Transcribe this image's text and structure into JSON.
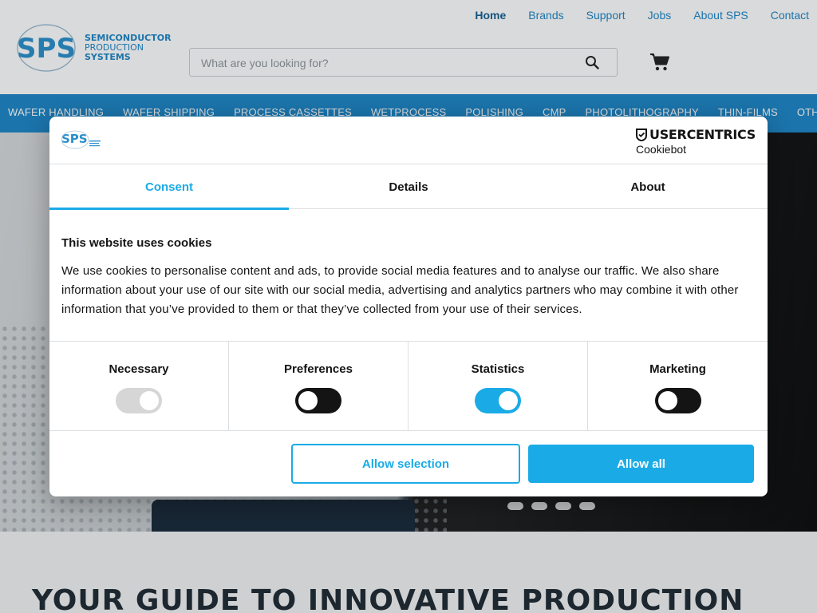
{
  "site": {
    "logo": {
      "mark": "SPS",
      "line1": "SEMICONDUCTOR",
      "line2": "PRODUCTION",
      "line3": "SYSTEMS"
    },
    "top_nav": [
      "Home",
      "Brands",
      "Support",
      "Jobs",
      "About SPS",
      "Contact"
    ],
    "search": {
      "placeholder": "What are you looking for?",
      "value": ""
    },
    "categories": [
      "WAFER HANDLING",
      "WAFER SHIPPING",
      "PROCESS CASSETTES",
      "WETPROCESS",
      "POLISHING",
      "CMP",
      "PHOTOLITHOGRAPHY",
      "THIN-FILMS",
      "OTHER"
    ],
    "tagline": "YOUR GUIDE TO INNOVATIVE PRODUCTION",
    "accent": "#1d86c6"
  },
  "dialog": {
    "brand": "USERCENTRICS",
    "brand_sub": "Cookiebot",
    "logo_mark": "SPS",
    "tabs": [
      {
        "label": "Consent",
        "active": true
      },
      {
        "label": "Details",
        "active": false
      },
      {
        "label": "About",
        "active": false
      }
    ],
    "heading": "This website uses cookies",
    "text": "We use cookies to personalise content and ads, to provide social media features and to analyse our traffic. We also share information about your use of our site with our social media, advertising and analytics partners who may combine it with other information that you’ve provided to them or that they’ve collected from your use of their services.",
    "toggles": [
      {
        "label": "Necessary",
        "state": "disabled-on"
      },
      {
        "label": "Preferences",
        "state": "off"
      },
      {
        "label": "Statistics",
        "state": "on"
      },
      {
        "label": "Marketing",
        "state": "off"
      }
    ],
    "buttons": {
      "allow_selection": "Allow selection",
      "allow_all": "Allow all"
    },
    "accent": "#1aabe6"
  }
}
